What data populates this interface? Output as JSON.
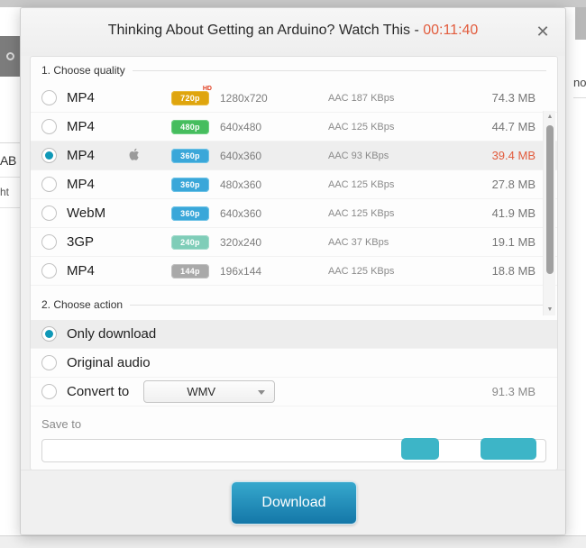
{
  "background": {
    "tab_icon": "circle-icon",
    "text_a": "AB",
    "text_b": "ht",
    "text_c": "no"
  },
  "dialog": {
    "title_text": "Thinking About Getting an Arduino? Watch This - ",
    "duration": "00:11:40",
    "close_icon": "✕",
    "accent_color": "#0f98b7",
    "duration_color": "#e25c3d"
  },
  "quality_section": {
    "heading": "1. Choose quality",
    "rows": [
      {
        "format": "MP4",
        "badge": "720p",
        "badge_class": "b720",
        "hd_tag": "HD",
        "apple": "",
        "resolution": "1280x720",
        "audio": "AAC 187  KBps",
        "size": "74.3 MB",
        "selected": false
      },
      {
        "format": "MP4",
        "badge": "480p",
        "badge_class": "b480",
        "hd_tag": "",
        "apple": "",
        "resolution": "640x480",
        "audio": "AAC 125  KBps",
        "size": "44.7 MB",
        "selected": false
      },
      {
        "format": "MP4",
        "badge": "360p",
        "badge_class": "b360",
        "hd_tag": "",
        "apple": "",
        "resolution": "640x360",
        "audio": "AAC 93  KBps",
        "size": "39.4 MB",
        "selected": true
      },
      {
        "format": "MP4",
        "badge": "360p",
        "badge_class": "b360",
        "hd_tag": "",
        "apple": "",
        "resolution": "480x360",
        "audio": "AAC 125  KBps",
        "size": "27.8 MB",
        "selected": false
      },
      {
        "format": "WebM",
        "badge": "360p",
        "badge_class": "b360",
        "hd_tag": "",
        "apple": "",
        "resolution": "640x360",
        "audio": "AAC 125  KBps",
        "size": "41.9 MB",
        "selected": false
      },
      {
        "format": "3GP",
        "badge": "240p",
        "badge_class": "b240",
        "hd_tag": "",
        "apple": "",
        "resolution": "320x240",
        "audio": "AAC 37  KBps",
        "size": "19.1 MB",
        "selected": false
      },
      {
        "format": "MP4",
        "badge": "144p",
        "badge_class": "b144",
        "hd_tag": "",
        "apple": "",
        "resolution": "196x144",
        "audio": "AAC 125  KBps",
        "size": "18.8 MB",
        "selected": false
      }
    ],
    "scroll_up_icon": "▲",
    "scroll_down_icon": "▼"
  },
  "action_section": {
    "heading": "2. Choose action",
    "rows": [
      {
        "label": "Only download",
        "selected": true
      },
      {
        "label": "Original audio",
        "selected": false
      },
      {
        "label": "Convert to",
        "selected": false
      }
    ],
    "format_value": "WMV",
    "convert_size": "91.3 MB"
  },
  "save_to": {
    "label": "Save to",
    "path": ""
  },
  "footer": {
    "download_label": "Download"
  }
}
